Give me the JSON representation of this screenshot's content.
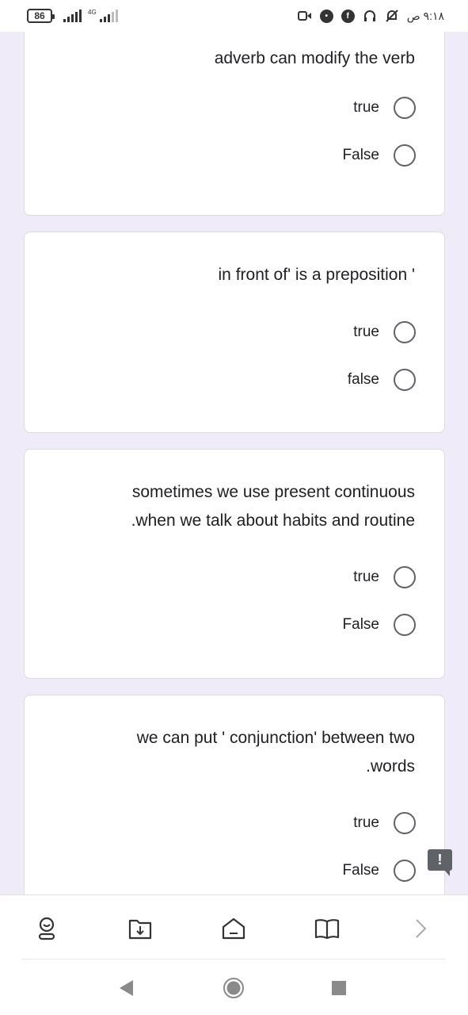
{
  "status_bar": {
    "battery": "86",
    "network_type": "4G",
    "time": "٩:١٨ ص",
    "icons": [
      "video-icon",
      "info-icon",
      "facebook-icon",
      "headset-icon",
      "mute-icon"
    ]
  },
  "questions": [
    {
      "text": "adverb can modify the verb",
      "options": [
        {
          "label": "true"
        },
        {
          "label": "False"
        }
      ]
    },
    {
      "text": "in front of' is a preposition '",
      "options": [
        {
          "label": "true"
        },
        {
          "label": "false"
        }
      ]
    },
    {
      "text_lines": [
        "sometimes we use present continuous",
        ".when we talk about habits and routine"
      ],
      "options": [
        {
          "label": "true"
        },
        {
          "label": "False"
        }
      ]
    },
    {
      "text_lines": [
        "we can put ' conjunction' between two",
        ".words"
      ],
      "options": [
        {
          "label": "true"
        },
        {
          "label": "False"
        }
      ]
    }
  ],
  "report_button": "!",
  "toolbar": {
    "icons": [
      "user-icon",
      "download-folder-icon",
      "home-icon",
      "book-icon",
      "chevron-right-icon"
    ]
  },
  "navigation": {
    "icons": [
      "back-icon",
      "home-circle-icon",
      "recents-icon"
    ]
  },
  "colors": {
    "background": "#f0ebf8",
    "card": "#ffffff",
    "radio_border": "#5f6368",
    "text": "#202124"
  }
}
